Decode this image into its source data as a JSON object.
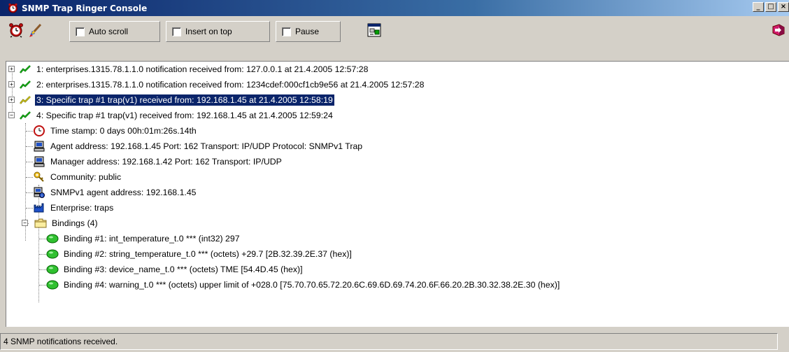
{
  "window": {
    "title": "SNMP Trap Ringer Console",
    "controls": {
      "minimize": "_",
      "maximize": "□",
      "close": "×"
    }
  },
  "toolbar": {
    "auto_scroll": {
      "label": "Auto scroll",
      "checked": false
    },
    "insert_on_top": {
      "label": "Insert on top",
      "checked": false
    },
    "pause": {
      "label": "Pause",
      "checked": false
    },
    "icons": [
      "alarm-clock-icon",
      "clear-brush-icon",
      "settings-dialog-icon",
      "exit-icon"
    ]
  },
  "tree": {
    "notifications": [
      {
        "label": "1: enterprises.1315.78.1.1.0 notification received from: 127.0.0.1 at 21.4.2005 12:57:28",
        "expanded": false,
        "selected": false
      },
      {
        "label": "2: enterprises.1315.78.1.1.0 notification received from: 1234cdef:000cf1cb9e56 at 21.4.2005 12:57:28",
        "expanded": false,
        "selected": false
      },
      {
        "label": "3: Specific trap #1 trap(v1) received from: 192.168.1.45 at 21.4.2005 12:58:19",
        "expanded": false,
        "selected": true
      },
      {
        "label": "4: Specific trap #1 trap(v1) received from: 192.168.1.45 at 21.4.2005 12:59:24",
        "expanded": true,
        "selected": false
      }
    ],
    "details": {
      "timestamp": "Time stamp: 0 days 00h:01m:26s.14th",
      "agent": "Agent address: 192.168.1.45 Port: 162 Transport: IP/UDP Protocol: SNMPv1 Trap",
      "manager": "Manager address: 192.168.1.42 Port: 162 Transport: IP/UDP",
      "community": "Community: public",
      "snmpv1_agent": "SNMPv1 agent address: 192.168.1.45",
      "enterprise": "Enterprise: traps",
      "bindings_folder": "Bindings (4)"
    },
    "bindings": [
      "Binding #1: int_temperature_t.0 *** (int32) 297",
      "Binding #2: string_temperature_t.0 *** (octets) +29.7 [2B.32.39.2E.37 (hex)]",
      "Binding #3: device_name_t.0 *** (octets) TME [54.4D.45 (hex)]",
      "Binding #4: warning_t.0 *** (octets) upper limit of +028.0 [75.70.70.65.72.20.6C.69.6D.69.74.20.6F.66.20.2B.30.32.38.2E.30 (hex)]"
    ]
  },
  "status": {
    "text": "4 SNMP notifications received."
  },
  "colors": {
    "title_gradient_start": "#0a246a",
    "selection": "#0a246a",
    "face": "#d4d0c8"
  }
}
